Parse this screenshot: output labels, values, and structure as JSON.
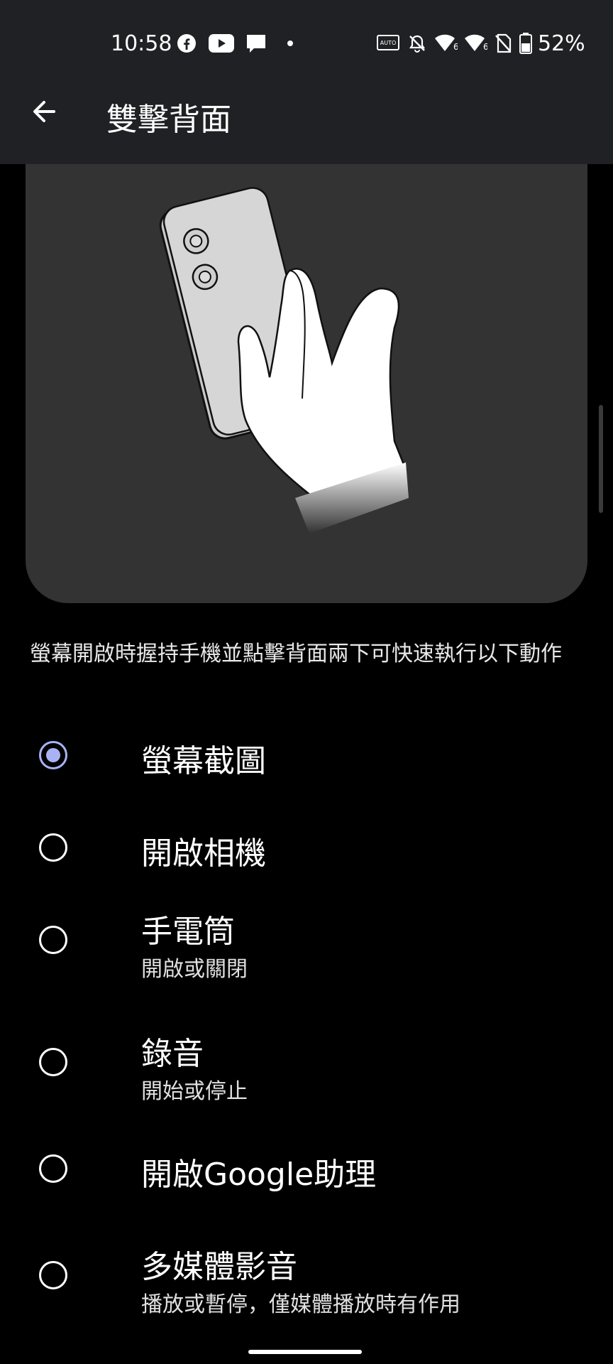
{
  "status_bar": {
    "time": "10:58",
    "battery": "52%",
    "icons": [
      "facebook-icon",
      "youtube-icon",
      "message-icon",
      "dot-icon",
      "auto-hz-icon",
      "bell-off-icon",
      "wifi-6-icon",
      "wifi-6-icon",
      "no-sim-icon",
      "battery-icon"
    ],
    "auto_label": "AUTO"
  },
  "app_bar": {
    "back_icon": "arrow-left-icon",
    "title": "雙擊背面"
  },
  "illustration": {
    "name": "hand-holding-phone-illustration"
  },
  "description": "螢幕開啟時握持手機並點擊背面兩下可快速執行以下動作",
  "options": [
    {
      "title": "螢幕截圖",
      "subtitle": "",
      "checked": true
    },
    {
      "title": "開啟相機",
      "subtitle": "",
      "checked": false
    },
    {
      "title": "手電筒",
      "subtitle": "開啟或關閉",
      "checked": false
    },
    {
      "title": "錄音",
      "subtitle": "開始或停止",
      "checked": false
    },
    {
      "title": "開啟Google助理",
      "subtitle": "",
      "checked": false
    },
    {
      "title": "多媒體影音",
      "subtitle": "播放或暫停，僅媒體播放時有作用",
      "checked": false
    }
  ],
  "colors": {
    "accent": "#a9b3f4",
    "app_bar_bg": "#202124",
    "illustration_bg": "#333333",
    "background": "#000000"
  }
}
